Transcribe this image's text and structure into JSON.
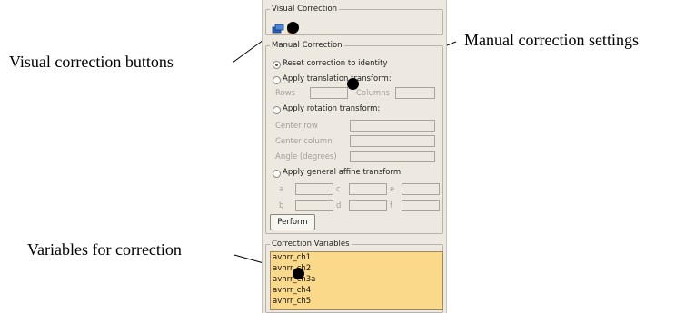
{
  "callouts": {
    "visual_buttons": "Visual correction buttons",
    "manual_settings": "Manual correction settings",
    "variables": "Variables for correction"
  },
  "panel": {
    "visual_correction_title": "Visual Correction",
    "manual_correction_title": "Manual Correction",
    "reset_label": "Reset correction to identity",
    "translation_label": "Apply translation transform:",
    "rows_label": "Rows",
    "columns_label": "Columns",
    "rotation_label": "Apply rotation transform:",
    "center_row_label": "Center row",
    "center_column_label": "Center column",
    "angle_label": "Angle (degrees)",
    "affine_label": "Apply general affine transform:",
    "affine_a": "a",
    "affine_b": "b",
    "affine_c": "c",
    "affine_d": "d",
    "affine_e": "e",
    "affine_f": "f",
    "perform_label": "Perform",
    "selected_option": "Reset correction to identity",
    "variables_title": "Correction Variables",
    "variables": [
      "avhrr_ch1",
      "avhrr_ch2",
      "avhrr_ch3a",
      "avhrr_ch4",
      "avhrr_ch5"
    ]
  },
  "colors": {
    "panel_bg": "#ede9e0",
    "variable_list_bg": "#fbd98b"
  }
}
